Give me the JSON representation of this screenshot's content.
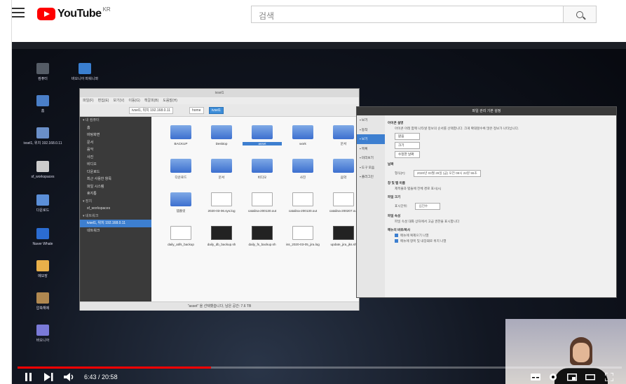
{
  "header": {
    "logo_text": "YouTube",
    "country_code": "KR",
    "search_placeholder": "검색"
  },
  "desktop_icons": [
    {
      "label": "컴퓨터",
      "color": "#555c66"
    },
    {
      "label": "바오니아 파워니와",
      "color": "#3a7fd0"
    },
    {
      "label": "홈",
      "color": "#4a7fc8"
    },
    {
      "label": "ivsel1, 위치 192.168.0.11",
      "color": "#6a8fc8"
    },
    {
      "label": "sf_workspaces",
      "color": "#cccccc"
    },
    {
      "label": "다운로드",
      "color": "#5b8fd8"
    },
    {
      "label": "Naver Whale",
      "color": "#2b6cd1"
    },
    {
      "label": "메모장",
      "color": "#e8b04a"
    },
    {
      "label": "압축해제",
      "color": "#b08850"
    },
    {
      "label": "바오니아",
      "color": "#7a7ad8"
    }
  ],
  "file_manager": {
    "title": "ivsel1",
    "menu": [
      "파일(F)",
      "편집(E)",
      "보기(V)",
      "이동(G)",
      "책갈피(B)",
      "도움말(H)"
    ],
    "breadcrumb": [
      "ivsel1, 위치 192.168.0.11",
      "home",
      "ivsel1"
    ],
    "sidebar": [
      {
        "label": "내 컴퓨터",
        "header": true
      },
      {
        "label": "홈"
      },
      {
        "label": "바탕화면"
      },
      {
        "label": "문서"
      },
      {
        "label": "음악"
      },
      {
        "label": "사진"
      },
      {
        "label": "비디오"
      },
      {
        "label": "다운로드"
      },
      {
        "label": "최근 사용한 항목"
      },
      {
        "label": "파일 시스템"
      },
      {
        "label": "휴지통"
      },
      {
        "label": "장치",
        "header": true
      },
      {
        "label": "sf_workspaces"
      },
      {
        "label": "네트워크",
        "header": true
      },
      {
        "label": "ivsel1, 위치 192.168.0.11",
        "selected": true
      },
      {
        "label": "네트워크"
      }
    ],
    "items": [
      {
        "name": "BACKUP",
        "type": "folder"
      },
      {
        "name": "Desktop",
        "type": "folder"
      },
      {
        "name": "asset",
        "type": "folder",
        "selected": true
      },
      {
        "name": "work",
        "type": "folder"
      },
      {
        "name": "문서",
        "type": "folder"
      },
      {
        "name": "다운로드",
        "type": "folder"
      },
      {
        "name": "문서",
        "type": "folder"
      },
      {
        "name": "비디오",
        "type": "folder"
      },
      {
        "name": "사진",
        "type": "folder"
      },
      {
        "name": "음악",
        "type": "folder"
      },
      {
        "name": "템플릿",
        "type": "folder"
      },
      {
        "name": "2020-03-06.sys.log",
        "type": "text"
      },
      {
        "name": "catalina-200130.out",
        "type": "text"
      },
      {
        "name": "catalina-200130.out",
        "type": "text"
      },
      {
        "name": "catalina-200207.out",
        "type": "text"
      },
      {
        "name": "daily_atifs_backup",
        "type": "text"
      },
      {
        "name": "daily_db_backup.sh",
        "type": "term"
      },
      {
        "name": "daily_fs_backup.sh",
        "type": "term"
      },
      {
        "name": "iss_2020-03-05_jira.log",
        "type": "text"
      },
      {
        "name": "update_jira_jks.sh",
        "type": "term"
      }
    ],
    "status": "\"asset\" 을 선택했습니다, 남은 공간: 7.6 TB"
  },
  "preferences": {
    "title": "파일 관리 기본 설정",
    "sidebar": [
      {
        "label": "보기"
      },
      {
        "label": "동작"
      },
      {
        "label": "보기",
        "selected": true
      },
      {
        "label": "목록"
      },
      {
        "label": "미리보기"
      },
      {
        "label": "도구 모음"
      },
      {
        "label": "플러그인"
      }
    ],
    "icon_caption_title": "아이콘 설명",
    "icon_caption_desc": "아이콘 아래 함께 나타낼 정보의 순서를 선택합니다. 크게 확대할수록 많은 정보가 나타납니다.",
    "caption_values": [
      "없음",
      "크기",
      "수정한 날짜"
    ],
    "date_title": "날짜",
    "date_format_label": "형식(F):",
    "date_format_value": "2020년 03월 26일 (금) 오전 08시 22분 55초",
    "fullpath_title": "창 및 탭 이름",
    "fullpath_desc": "제목줄과 탭들에 전체 경로 표시(A)",
    "filesize_title": "파일 크기",
    "filesize_label": "표시단위:",
    "filesize_value": "십진수",
    "fileprops_title": "파일 속성",
    "fileprops_desc": "파일 속성 대화 상자에서 고급 권한을 표시합니다",
    "menu_title": "메뉴의 바로/복사",
    "check1": "메뉴에 복제으기 나열",
    "check2": "메뉴에 항목 및 내장돼로 위치 나열"
  },
  "player": {
    "current_time": "6:43",
    "duration": "20:58",
    "progress_fraction": 0.32
  }
}
